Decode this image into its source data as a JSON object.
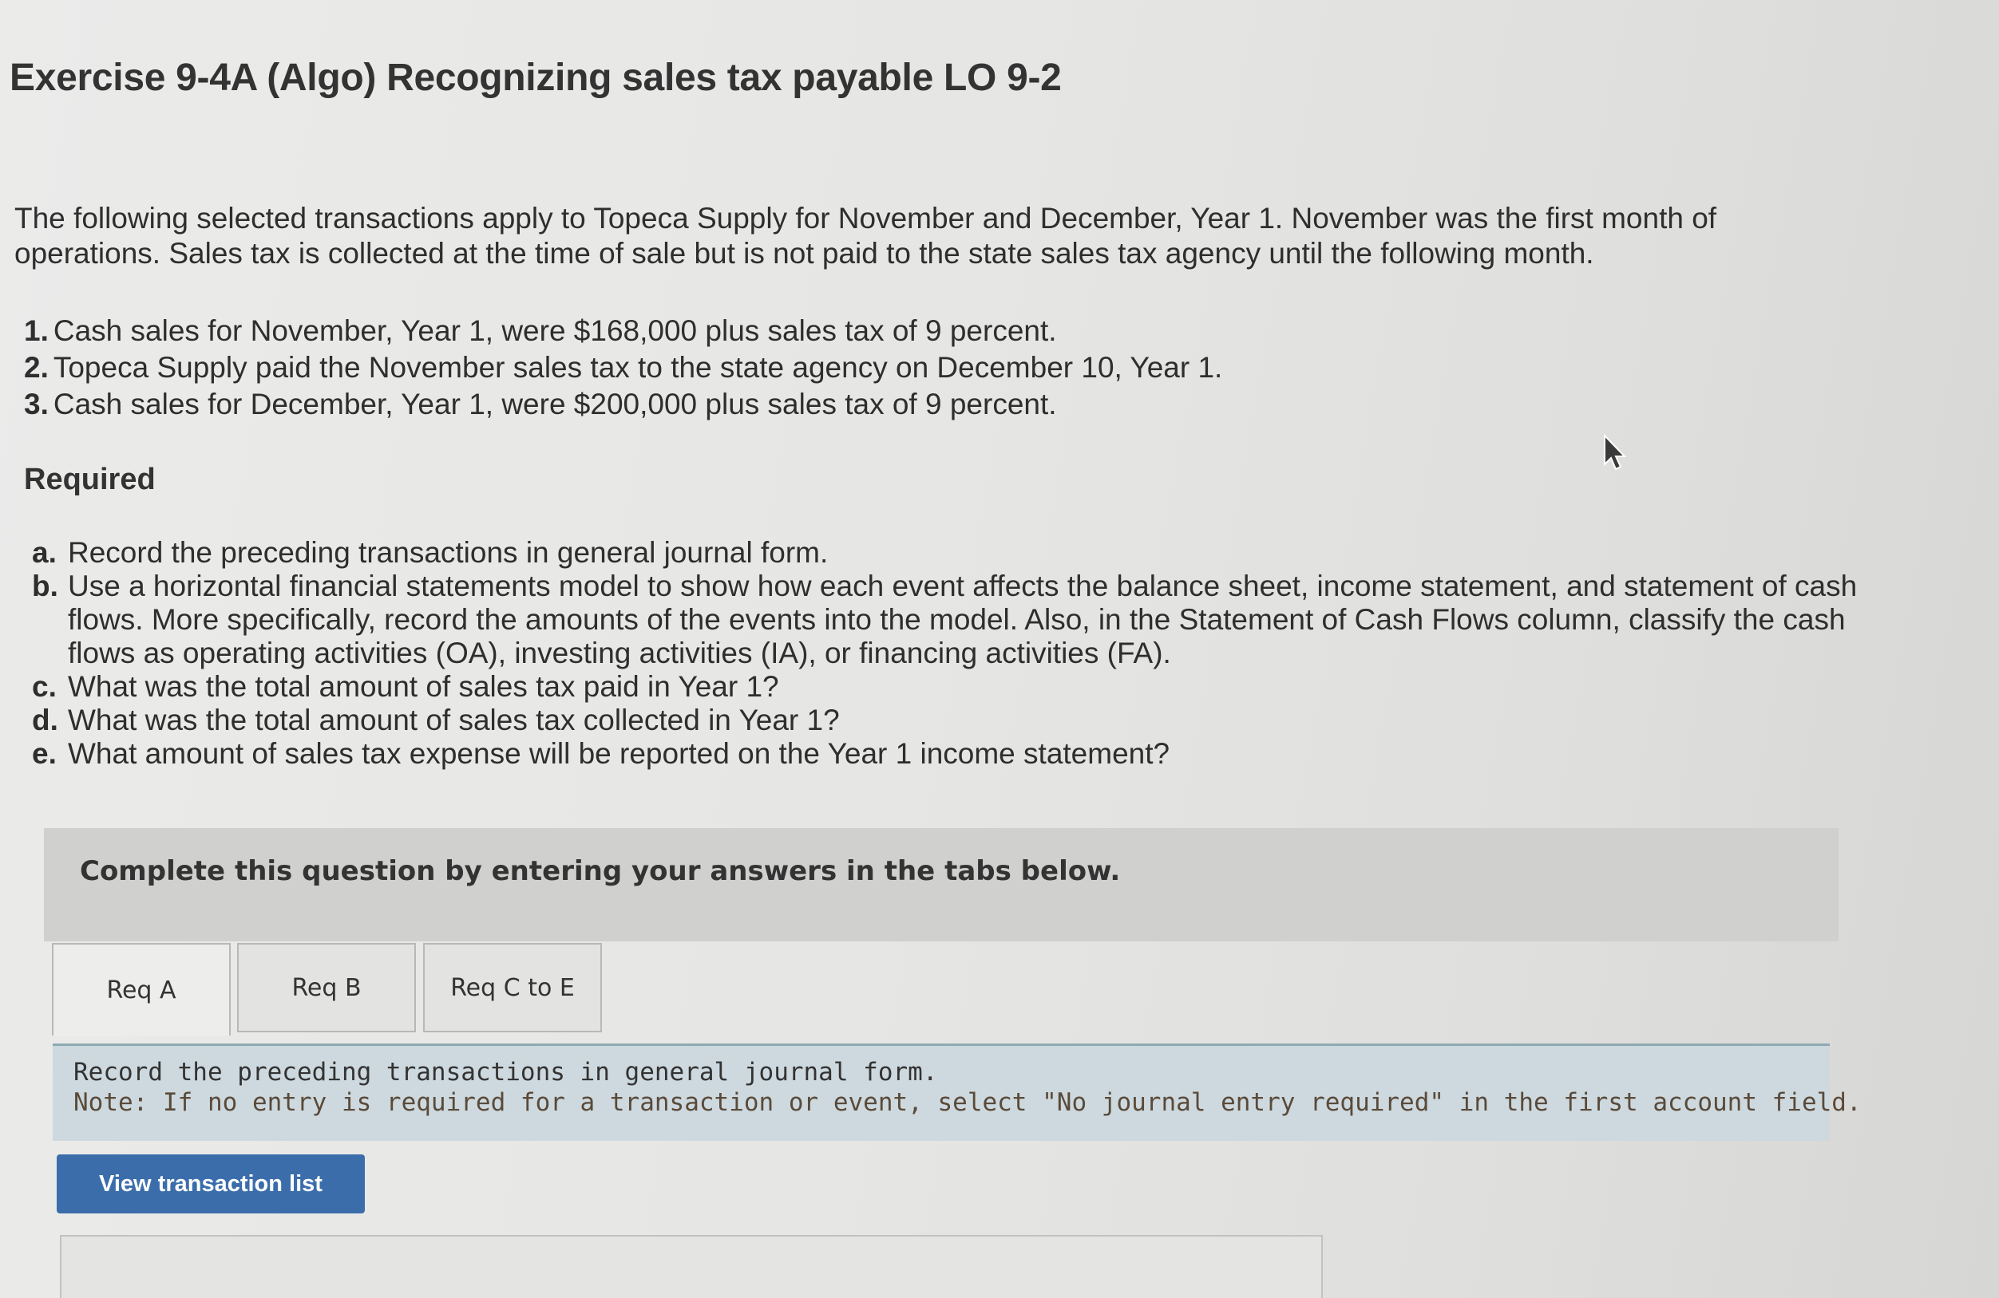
{
  "exercise": {
    "title": "Exercise 9-4A (Algo) Recognizing sales tax payable LO 9-2",
    "intro": "The following selected transactions apply to Topeca Supply for November and December, Year 1. November was the first month of operations. Sales tax is collected at the time of sale but is not paid to the state sales tax agency until the following month.",
    "transactions": [
      {
        "num": "1.",
        "text": "Cash sales for November, Year 1, were $168,000 plus sales tax of 9 percent."
      },
      {
        "num": "2.",
        "text": "Topeca Supply paid the November sales tax to the state agency on December 10, Year 1."
      },
      {
        "num": "3.",
        "text": "Cash sales for December, Year 1, were $200,000 plus sales tax of 9 percent."
      }
    ],
    "required_heading": "Required",
    "requirements": [
      {
        "letter": "a.",
        "text": "Record the preceding transactions in general journal form."
      },
      {
        "letter": "b.",
        "text": "Use a horizontal financial statements model to show how each event affects the balance sheet, income statement, and statement of cash flows. More specifically, record the amounts of the events into the model. Also, in the Statement of Cash Flows column, classify the cash flows as operating activities (OA), investing activities (IA), or financing activities (FA)."
      },
      {
        "letter": "c.",
        "text": "What was the total amount of sales tax paid in Year 1?"
      },
      {
        "letter": "d.",
        "text": "What was the total amount of sales tax collected in Year 1?"
      },
      {
        "letter": "e.",
        "text": "What amount of sales tax expense will be reported on the Year 1 income statement?"
      }
    ]
  },
  "answer_panel": {
    "instruction": "Complete this question by entering your answers in the tabs below.",
    "tabs": [
      {
        "label": "Req A",
        "active": true
      },
      {
        "label": "Req B",
        "active": false
      },
      {
        "label": "Req C to E",
        "active": false
      }
    ],
    "note_line1": "Record the preceding transactions in general journal form.",
    "note_line2": "Note: If no entry is required for a transaction or event, select \"No journal entry required\" in the first account field.",
    "view_button_label": "View transaction list"
  },
  "colors": {
    "button": "#3b6dab",
    "note_background": "#cdd9de",
    "banner": "#d0d0ce"
  }
}
